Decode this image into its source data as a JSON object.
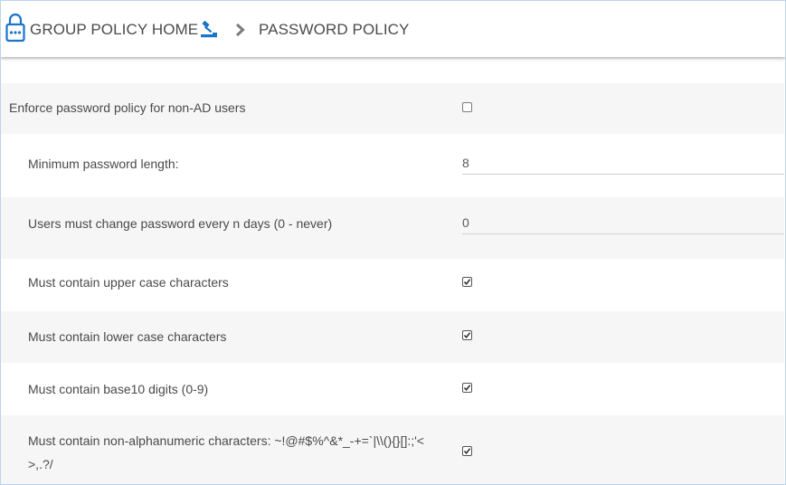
{
  "breadcrumb": {
    "home_label": "GROUP POLICY HOME",
    "current_label": "PASSWORD POLICY"
  },
  "settings": {
    "enforce_non_ad": {
      "label": "Enforce password policy for non-AD users",
      "checked": false
    },
    "min_length": {
      "label": "Minimum password length:",
      "value": "8"
    },
    "change_every_days": {
      "label": "Users must change password every n days (0 - never)",
      "value": "0"
    },
    "upper_case": {
      "label": "Must contain upper case characters",
      "checked": true
    },
    "lower_case": {
      "label": "Must contain lower case characters",
      "checked": true
    },
    "digits": {
      "label": "Must contain base10 digits (0-9)",
      "checked": true
    },
    "non_alnum": {
      "label": "Must contain non-alphanumeric characters: ~!@#$%^&*_-+=`|\\\\(){}[]:;'<>,.?/",
      "checked": true
    }
  },
  "colors": {
    "accent": "#1a74c9",
    "frame_border": "#b9d4ee",
    "row_shade": "#f6f6f6"
  },
  "icons": {
    "lock": "lock-icon",
    "gavel": "gavel-icon",
    "chevron": "chevron-right-icon"
  }
}
